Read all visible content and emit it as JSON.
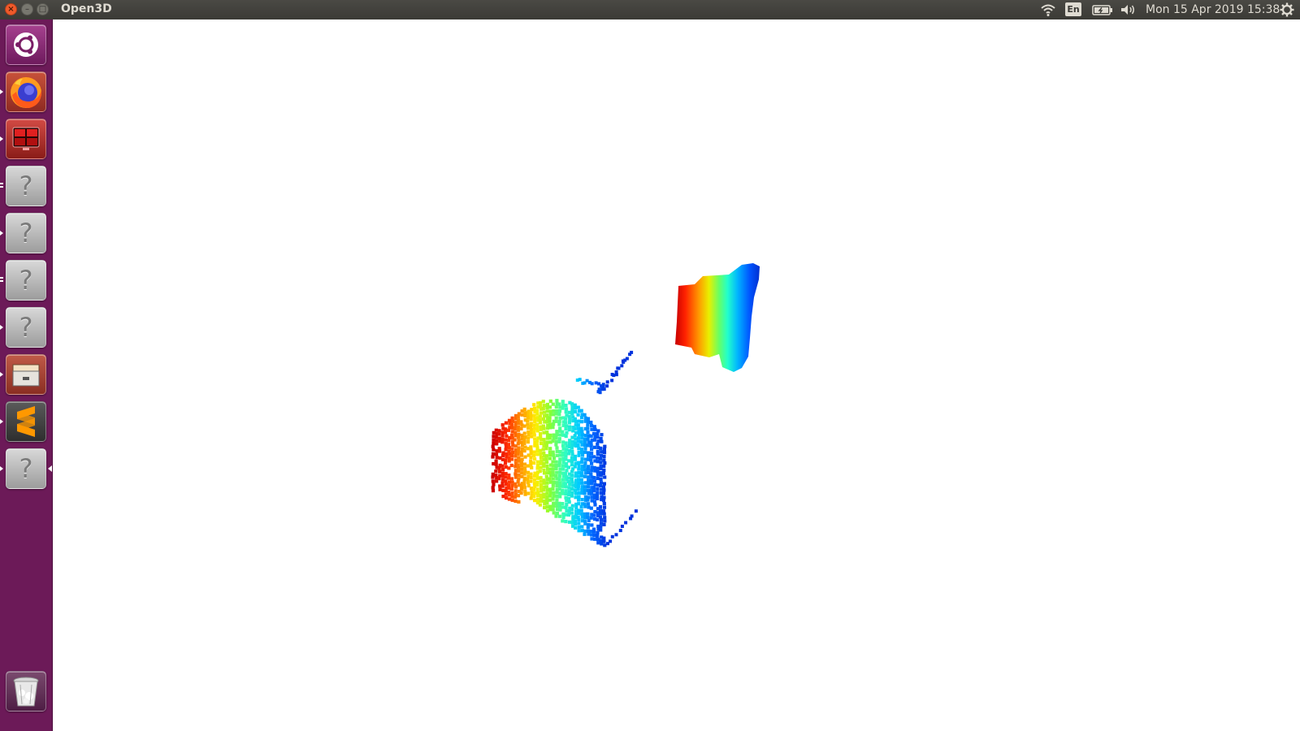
{
  "window": {
    "title": "Open3D",
    "buttons": {
      "close": "×",
      "minimize": "–",
      "maximize": "□"
    }
  },
  "panel": {
    "keyboard_layout": "En",
    "clock": "Mon 15 Apr 2019 15:38",
    "icons": [
      "wifi-icon",
      "keyboard-layout-badge",
      "battery-icon",
      "volume-icon",
      "gear-icon"
    ]
  },
  "launcher": {
    "items": [
      {
        "name": "ubuntu-dash",
        "icon": "ubuntu-logo-icon",
        "running": false
      },
      {
        "name": "firefox",
        "icon": "firefox-icon",
        "running": true
      },
      {
        "name": "screen-app",
        "icon": "red-screen-icon",
        "running": true
      },
      {
        "name": "unknown-app-1",
        "icon": "question-mark-icon",
        "label": "?",
        "running": true,
        "windows": 2
      },
      {
        "name": "unknown-app-2",
        "icon": "question-mark-icon",
        "label": "?",
        "running": true
      },
      {
        "name": "unknown-app-3",
        "icon": "question-mark-icon",
        "label": "?",
        "running": true,
        "windows": 2
      },
      {
        "name": "unknown-app-4",
        "icon": "question-mark-icon",
        "label": "?",
        "running": true
      },
      {
        "name": "file-cabinet",
        "icon": "file-cabinet-icon",
        "running": true
      },
      {
        "name": "sublime-text",
        "icon": "sublime-text-icon",
        "running": true
      },
      {
        "name": "unknown-app-5",
        "icon": "question-mark-icon",
        "label": "?",
        "running": true,
        "active": true
      },
      {
        "name": "trash",
        "icon": "trash-icon",
        "running": false
      }
    ]
  },
  "viewer": {
    "background": "#ffffff",
    "colormap": [
      "#cc0000",
      "#ff2a00",
      "#ff9900",
      "#ffee00",
      "#88ff33",
      "#33ffbb",
      "#00ccff",
      "#0066ff",
      "#0033dd"
    ]
  }
}
